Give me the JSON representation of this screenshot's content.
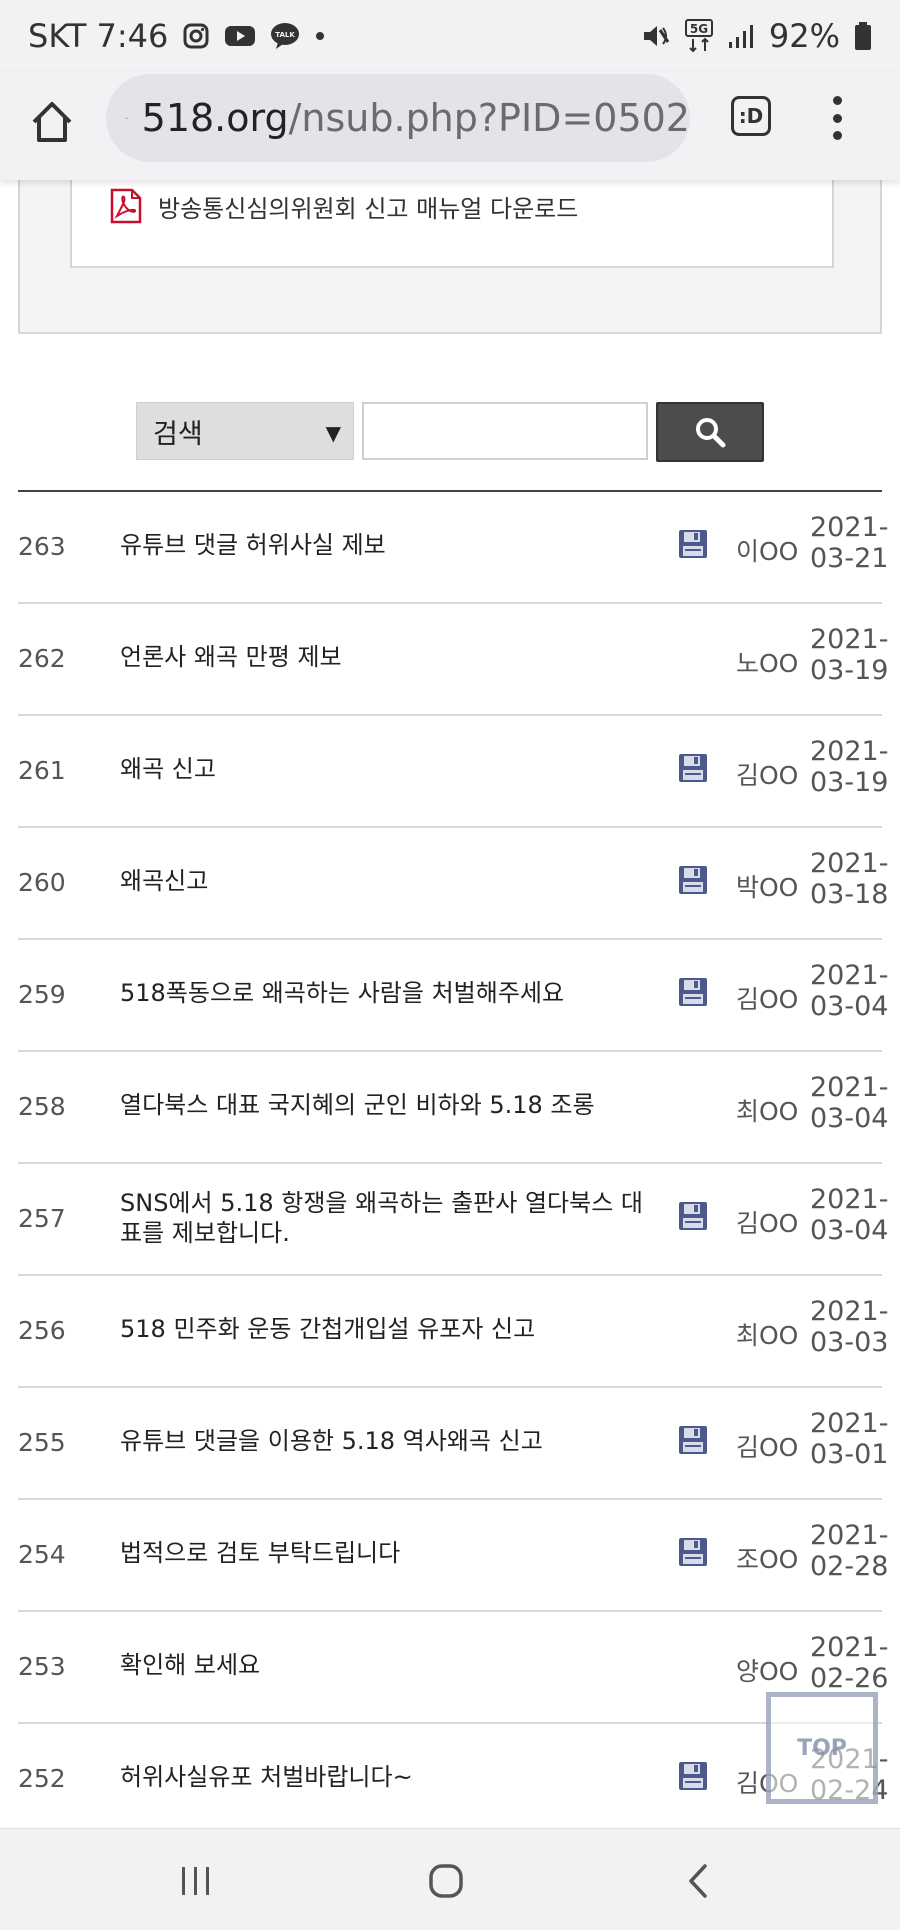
{
  "status_bar": {
    "carrier_time": "SKT 7:46",
    "network": "5G",
    "battery": "92%"
  },
  "browser": {
    "url_host": "518.org",
    "url_path": "/nsub.php?PID=0502",
    "tab_label": ":D"
  },
  "manual": {
    "download_label": "방송통신심의위원회 신고 매뉴얼 다운로드"
  },
  "search": {
    "select_value": "검색",
    "input_value": ""
  },
  "posts": [
    {
      "num": "263",
      "title": "유튜브 댓글 허위사실 제보",
      "has_file": true,
      "author": "이OO",
      "date_year": "2021-",
      "date_md": "03-21"
    },
    {
      "num": "262",
      "title": "언론사 왜곡 만평 제보",
      "has_file": false,
      "author": "노OO",
      "date_year": "2021-",
      "date_md": "03-19"
    },
    {
      "num": "261",
      "title": "왜곡 신고",
      "has_file": true,
      "author": "김OO",
      "date_year": "2021-",
      "date_md": "03-19"
    },
    {
      "num": "260",
      "title": "왜곡신고",
      "has_file": true,
      "author": "박OO",
      "date_year": "2021-",
      "date_md": "03-18"
    },
    {
      "num": "259",
      "title": "518폭동으로 왜곡하는 사람을 처벌해주세요",
      "has_file": true,
      "author": "김OO",
      "date_year": "2021-",
      "date_md": "03-04"
    },
    {
      "num": "258",
      "title": "열다북스 대표 국지혜의 군인 비하와 5.18 조롱",
      "has_file": false,
      "author": "최OO",
      "date_year": "2021-",
      "date_md": "03-04"
    },
    {
      "num": "257",
      "title": "SNS에서 5.18 항쟁을 왜곡하는 출판사 열다북스 대표를 제보합니다.",
      "has_file": true,
      "author": "김OO",
      "date_year": "2021-",
      "date_md": "03-04"
    },
    {
      "num": "256",
      "title": "518 민주화 운동 간첩개입설 유포자 신고",
      "has_file": false,
      "author": "최OO",
      "date_year": "2021-",
      "date_md": "03-03"
    },
    {
      "num": "255",
      "title": "유튜브 댓글을 이용한 5.18 역사왜곡 신고",
      "has_file": true,
      "author": "김OO",
      "date_year": "2021-",
      "date_md": "03-01"
    },
    {
      "num": "254",
      "title": "법적으로 검토 부탁드립니다",
      "has_file": true,
      "author": "조OO",
      "date_year": "2021-",
      "date_md": "02-28"
    },
    {
      "num": "253",
      "title": "확인해 보세요",
      "has_file": false,
      "author": "양OO",
      "date_year": "2021-",
      "date_md": "02-26"
    },
    {
      "num": "252",
      "title": "허위사실유포 처벌바랍니다~",
      "has_file": true,
      "author": "김OO",
      "date_year": "2021-",
      "date_md": "02-24"
    }
  ],
  "top_button": {
    "label": "TOP"
  },
  "colors": {
    "chrome_bg": "#f2f2f4",
    "file_icon": "#4a5a8a",
    "search_button": "#4c4c4c",
    "pdf_red": "#c8102e"
  }
}
